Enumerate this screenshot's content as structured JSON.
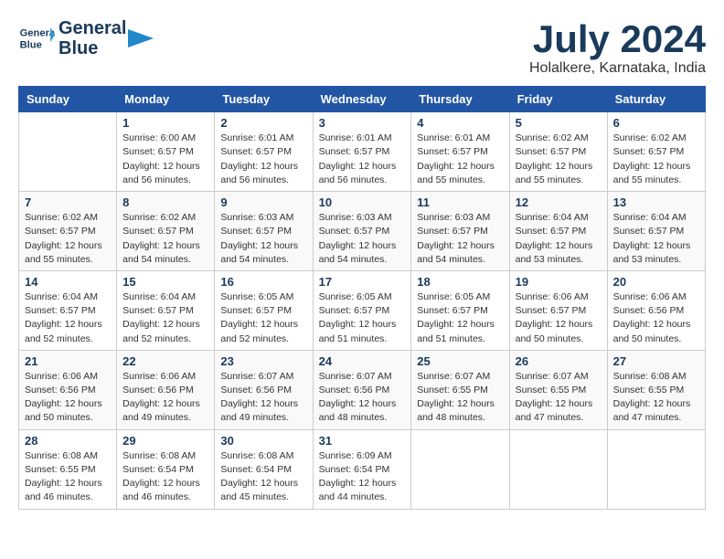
{
  "logo": {
    "line1": "General",
    "line2": "Blue"
  },
  "title": "July 2024",
  "location": "Holalkere, Karnataka, India",
  "days_of_week": [
    "Sunday",
    "Monday",
    "Tuesday",
    "Wednesday",
    "Thursday",
    "Friday",
    "Saturday"
  ],
  "weeks": [
    [
      {
        "day": "",
        "info": ""
      },
      {
        "day": "1",
        "info": "Sunrise: 6:00 AM\nSunset: 6:57 PM\nDaylight: 12 hours\nand 56 minutes."
      },
      {
        "day": "2",
        "info": "Sunrise: 6:01 AM\nSunset: 6:57 PM\nDaylight: 12 hours\nand 56 minutes."
      },
      {
        "day": "3",
        "info": "Sunrise: 6:01 AM\nSunset: 6:57 PM\nDaylight: 12 hours\nand 56 minutes."
      },
      {
        "day": "4",
        "info": "Sunrise: 6:01 AM\nSunset: 6:57 PM\nDaylight: 12 hours\nand 55 minutes."
      },
      {
        "day": "5",
        "info": "Sunrise: 6:02 AM\nSunset: 6:57 PM\nDaylight: 12 hours\nand 55 minutes."
      },
      {
        "day": "6",
        "info": "Sunrise: 6:02 AM\nSunset: 6:57 PM\nDaylight: 12 hours\nand 55 minutes."
      }
    ],
    [
      {
        "day": "7",
        "info": "Sunrise: 6:02 AM\nSunset: 6:57 PM\nDaylight: 12 hours\nand 55 minutes."
      },
      {
        "day": "8",
        "info": "Sunrise: 6:02 AM\nSunset: 6:57 PM\nDaylight: 12 hours\nand 54 minutes."
      },
      {
        "day": "9",
        "info": "Sunrise: 6:03 AM\nSunset: 6:57 PM\nDaylight: 12 hours\nand 54 minutes."
      },
      {
        "day": "10",
        "info": "Sunrise: 6:03 AM\nSunset: 6:57 PM\nDaylight: 12 hours\nand 54 minutes."
      },
      {
        "day": "11",
        "info": "Sunrise: 6:03 AM\nSunset: 6:57 PM\nDaylight: 12 hours\nand 54 minutes."
      },
      {
        "day": "12",
        "info": "Sunrise: 6:04 AM\nSunset: 6:57 PM\nDaylight: 12 hours\nand 53 minutes."
      },
      {
        "day": "13",
        "info": "Sunrise: 6:04 AM\nSunset: 6:57 PM\nDaylight: 12 hours\nand 53 minutes."
      }
    ],
    [
      {
        "day": "14",
        "info": "Sunrise: 6:04 AM\nSunset: 6:57 PM\nDaylight: 12 hours\nand 52 minutes."
      },
      {
        "day": "15",
        "info": "Sunrise: 6:04 AM\nSunset: 6:57 PM\nDaylight: 12 hours\nand 52 minutes."
      },
      {
        "day": "16",
        "info": "Sunrise: 6:05 AM\nSunset: 6:57 PM\nDaylight: 12 hours\nand 52 minutes."
      },
      {
        "day": "17",
        "info": "Sunrise: 6:05 AM\nSunset: 6:57 PM\nDaylight: 12 hours\nand 51 minutes."
      },
      {
        "day": "18",
        "info": "Sunrise: 6:05 AM\nSunset: 6:57 PM\nDaylight: 12 hours\nand 51 minutes."
      },
      {
        "day": "19",
        "info": "Sunrise: 6:06 AM\nSunset: 6:57 PM\nDaylight: 12 hours\nand 50 minutes."
      },
      {
        "day": "20",
        "info": "Sunrise: 6:06 AM\nSunset: 6:56 PM\nDaylight: 12 hours\nand 50 minutes."
      }
    ],
    [
      {
        "day": "21",
        "info": "Sunrise: 6:06 AM\nSunset: 6:56 PM\nDaylight: 12 hours\nand 50 minutes."
      },
      {
        "day": "22",
        "info": "Sunrise: 6:06 AM\nSunset: 6:56 PM\nDaylight: 12 hours\nand 49 minutes."
      },
      {
        "day": "23",
        "info": "Sunrise: 6:07 AM\nSunset: 6:56 PM\nDaylight: 12 hours\nand 49 minutes."
      },
      {
        "day": "24",
        "info": "Sunrise: 6:07 AM\nSunset: 6:56 PM\nDaylight: 12 hours\nand 48 minutes."
      },
      {
        "day": "25",
        "info": "Sunrise: 6:07 AM\nSunset: 6:55 PM\nDaylight: 12 hours\nand 48 minutes."
      },
      {
        "day": "26",
        "info": "Sunrise: 6:07 AM\nSunset: 6:55 PM\nDaylight: 12 hours\nand 47 minutes."
      },
      {
        "day": "27",
        "info": "Sunrise: 6:08 AM\nSunset: 6:55 PM\nDaylight: 12 hours\nand 47 minutes."
      }
    ],
    [
      {
        "day": "28",
        "info": "Sunrise: 6:08 AM\nSunset: 6:55 PM\nDaylight: 12 hours\nand 46 minutes."
      },
      {
        "day": "29",
        "info": "Sunrise: 6:08 AM\nSunset: 6:54 PM\nDaylight: 12 hours\nand 46 minutes."
      },
      {
        "day": "30",
        "info": "Sunrise: 6:08 AM\nSunset: 6:54 PM\nDaylight: 12 hours\nand 45 minutes."
      },
      {
        "day": "31",
        "info": "Sunrise: 6:09 AM\nSunset: 6:54 PM\nDaylight: 12 hours\nand 44 minutes."
      },
      {
        "day": "",
        "info": ""
      },
      {
        "day": "",
        "info": ""
      },
      {
        "day": "",
        "info": ""
      }
    ]
  ]
}
